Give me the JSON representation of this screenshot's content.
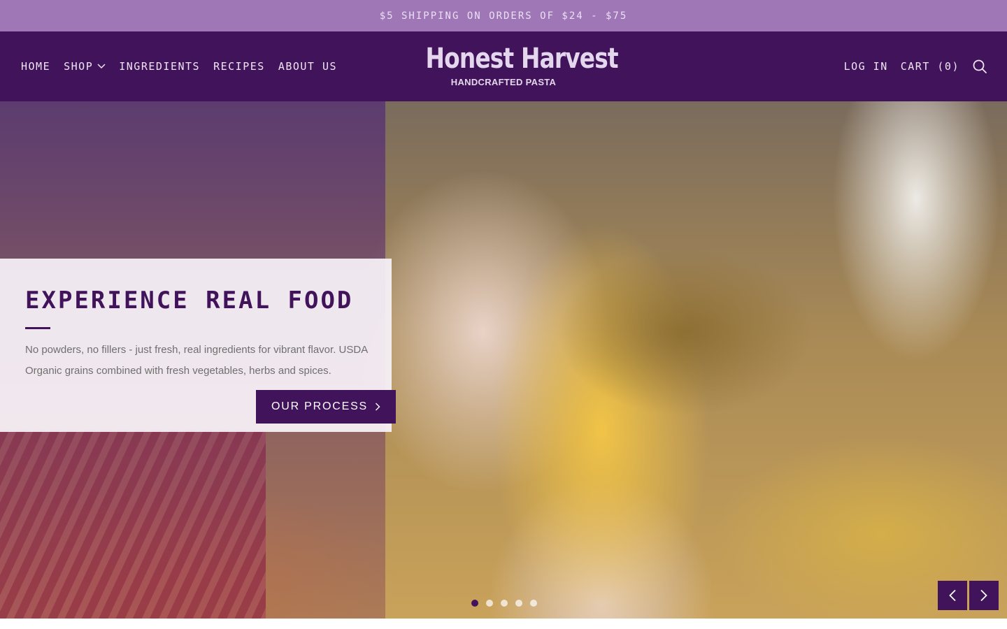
{
  "announcement": {
    "text": "$5 shipping on orders of $24 - $75"
  },
  "header": {
    "nav": [
      {
        "label": "Home"
      },
      {
        "label": "Shop"
      },
      {
        "label": "Ingredients"
      },
      {
        "label": "Recipes"
      },
      {
        "label": "About us"
      }
    ],
    "logo": {
      "title": "Honest Harvest",
      "subtitle": "HANDCRAFTED PASTA"
    },
    "login_label": "Log in",
    "cart_label": "Cart (0)",
    "search_icon": "search-icon"
  },
  "hero": {
    "title": "Experience real food",
    "text": "No powders, no fillers - just fresh, real ingredients for vibrant flavor. USDA Organic grains combined with fresh vegetables, herbs and spices.",
    "button_label": "Our Process",
    "slide_count": 5,
    "active_slide": 1,
    "prev_icon": "chevron-left-icon",
    "next_icon": "chevron-right-icon"
  },
  "colors": {
    "announcement_bg": "#a077b6",
    "brand_purple": "#41135b",
    "nav_text": "#efe6f5"
  }
}
